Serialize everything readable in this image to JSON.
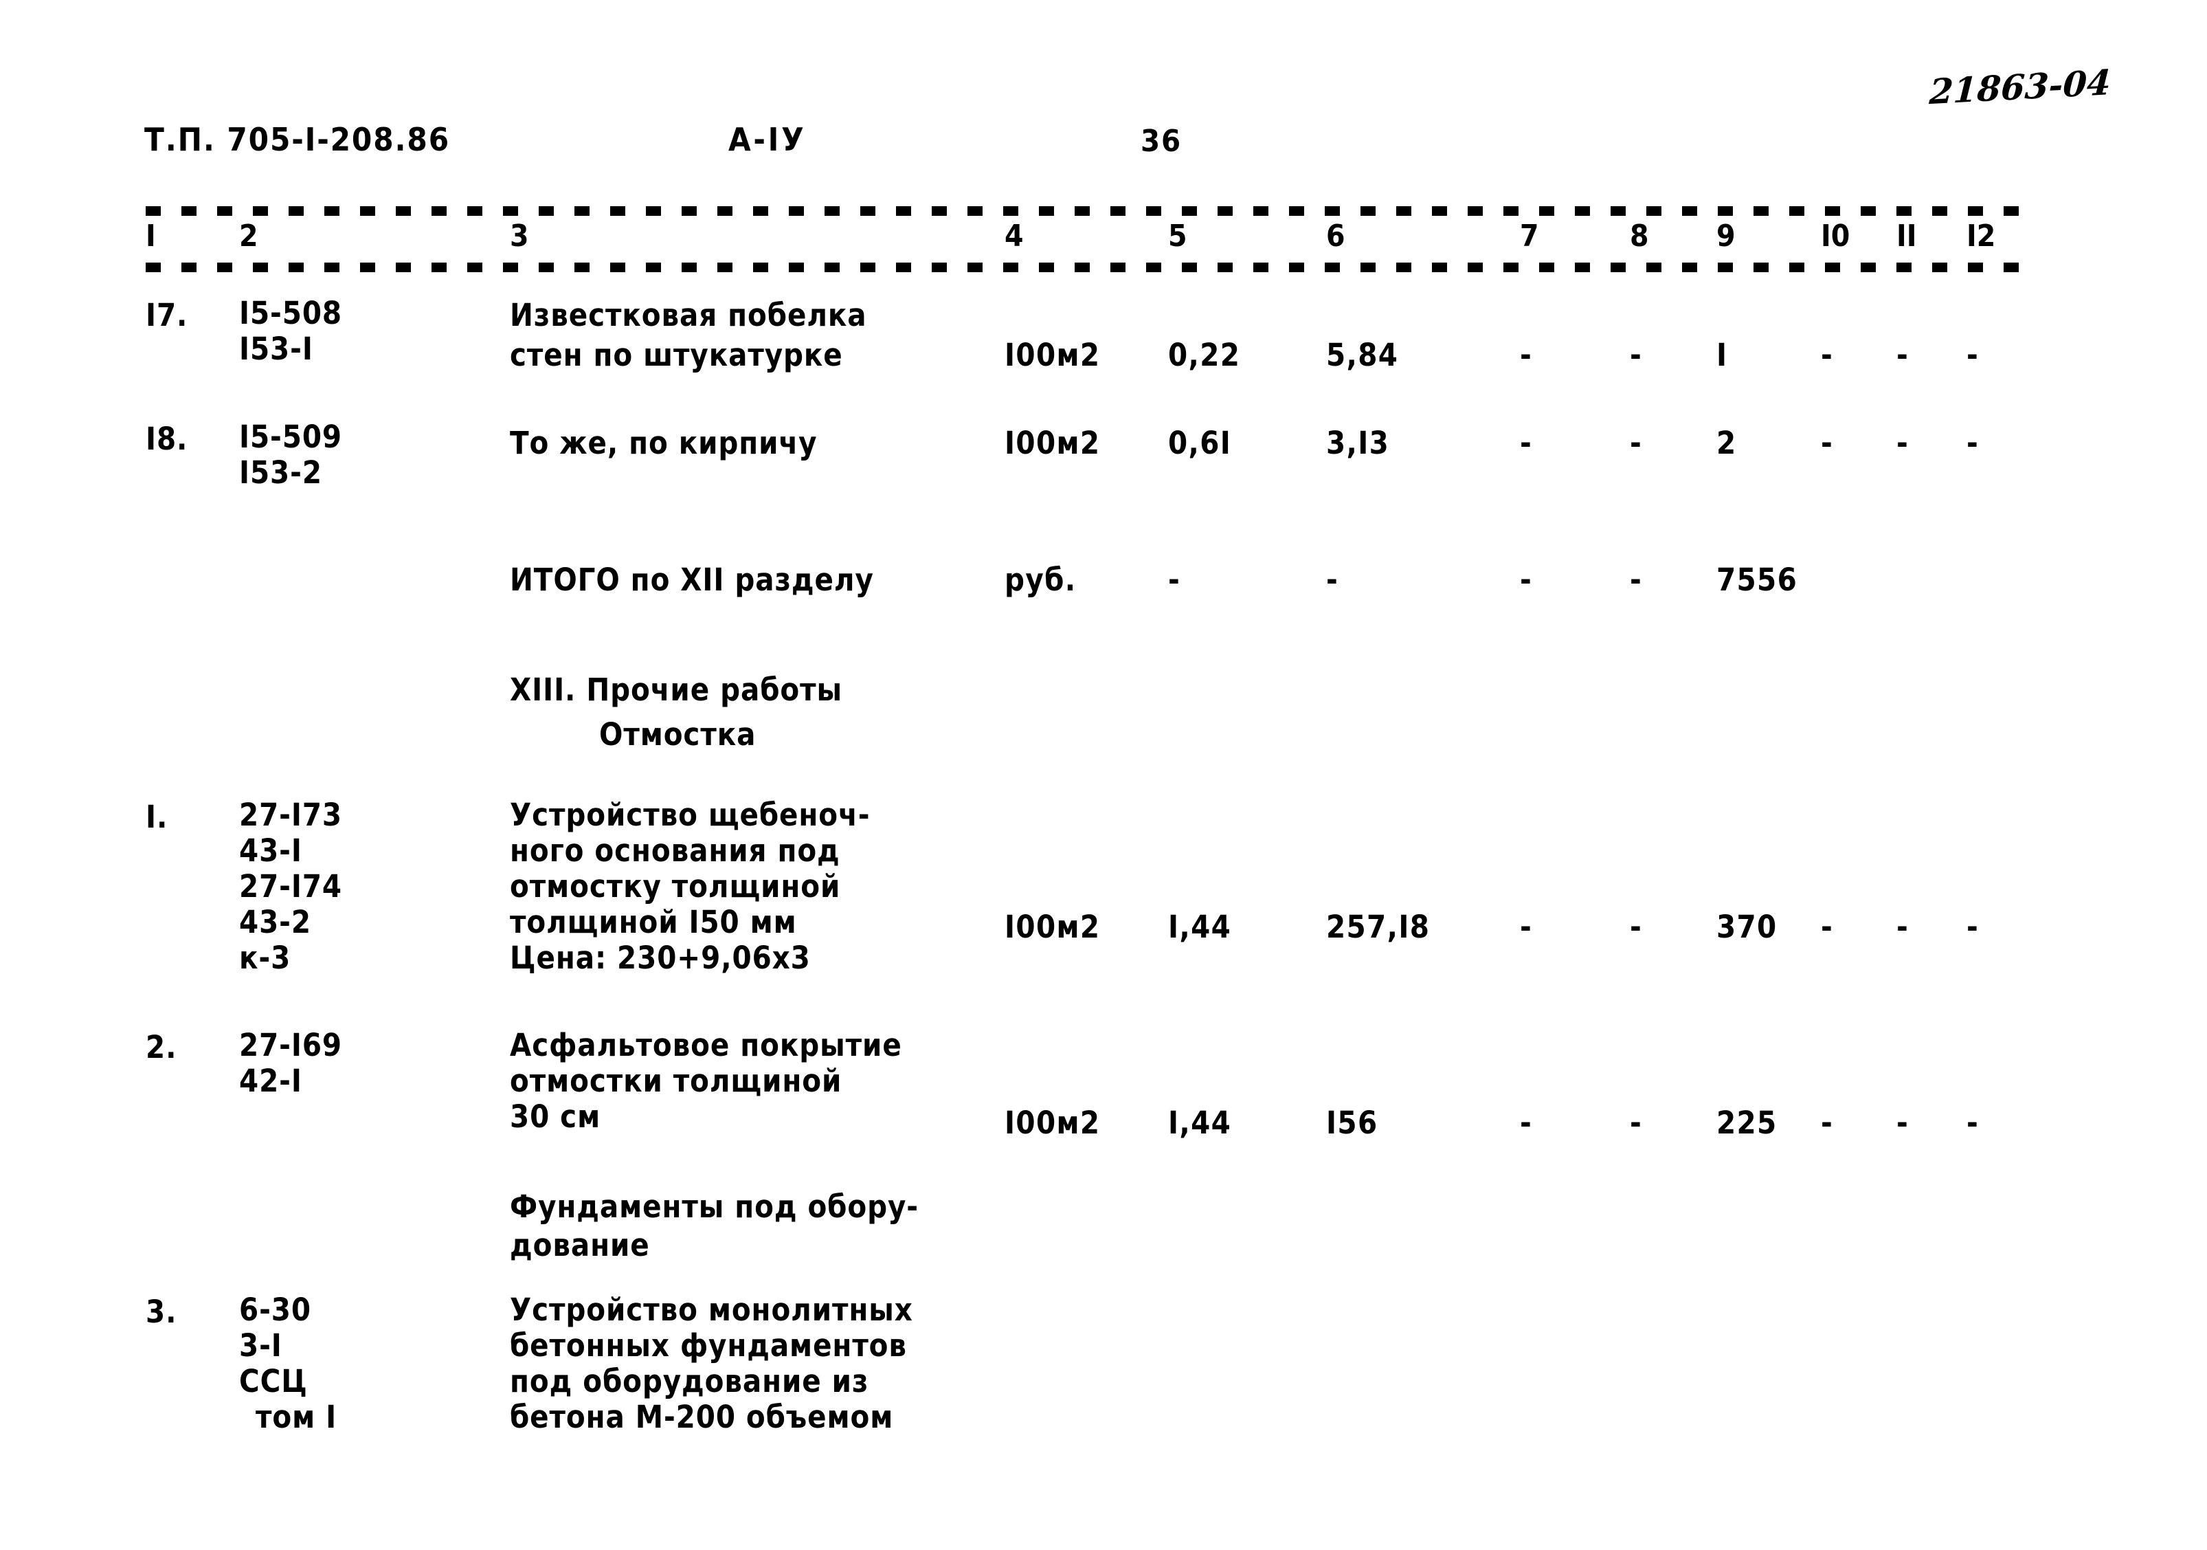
{
  "header": {
    "doc_code": "Т.П. 705-I-208.86",
    "album_code": "А-IУ",
    "page_number": "36",
    "archive_number": "21863-04"
  },
  "table": {
    "column_numbers": [
      "I",
      "2",
      "3",
      "4",
      "5",
      "6",
      "7",
      "8",
      "9",
      "I0",
      "II",
      "I2"
    ],
    "rows": [
      {
        "no": "I7.",
        "codes": [
          "I5-508",
          "I53-I"
        ],
        "description": [
          "Известковая побелка",
          "стен по штукатурке"
        ],
        "unit": "I00м2",
        "c5": "0,22",
        "c6": "5,84",
        "c7": "-",
        "c8": "-",
        "c9": "I",
        "c10": "-",
        "c11": "-",
        "c12": "-"
      },
      {
        "no": "I8.",
        "codes": [
          "I5-509",
          "I53-2"
        ],
        "description": [
          "То же, по кирпичу"
        ],
        "unit": "I00м2",
        "c5": "0,6I",
        "c6": "3,I3",
        "c7": "-",
        "c8": "-",
        "c9": "2",
        "c10": "-",
        "c11": "-",
        "c12": "-"
      },
      {
        "no": "",
        "codes": [],
        "description": [
          "ИТОГО по XII разделу"
        ],
        "unit": "руб.",
        "c5": "-",
        "c6": "-",
        "c7": "-",
        "c8": "-",
        "c9": "7556",
        "c10": "",
        "c11": "",
        "c12": ""
      },
      {
        "no": "I.",
        "codes": [
          "27-I73",
          "43-I",
          "27-I74",
          "43-2",
          "к-3"
        ],
        "description": [
          "Устройство щебеноч-",
          "ного основания под",
          "отмостку толщиной",
          "толщиной I50 мм",
          "Цена: 230+9,06х3"
        ],
        "unit": "I00м2",
        "c5": "I,44",
        "c6": "257,I8",
        "c7": "-",
        "c8": "-",
        "c9": "370",
        "c10": "-",
        "c11": "-",
        "c12": "-"
      },
      {
        "no": "2.",
        "codes": [
          "27-I69",
          "42-I"
        ],
        "description": [
          "Асфальтовое покрытие",
          "отмостки толщиной",
          "30 см"
        ],
        "unit": "I00м2",
        "c5": "I,44",
        "c6": "I56",
        "c7": "-",
        "c8": "-",
        "c9": "225",
        "c10": "-",
        "c11": "-",
        "c12": "-"
      },
      {
        "no": "3.",
        "codes": [
          "6-30",
          "3-I",
          "ССЦ",
          "том I"
        ],
        "description": [
          "Устройство монолитных",
          "бетонных фундаментов",
          "под оборудование из",
          "бетона М-200 объемом"
        ],
        "unit": "",
        "c5": "",
        "c6": "",
        "c7": "",
        "c8": "",
        "c9": "",
        "c10": "",
        "c11": "",
        "c12": ""
      }
    ],
    "headings": {
      "section_13": "XIII. Прочие работы",
      "subsection_otmostka": "Отмостка",
      "subsection_foundations_l1": "Фундаменты под обору-",
      "subsection_foundations_l2": "дование"
    }
  }
}
